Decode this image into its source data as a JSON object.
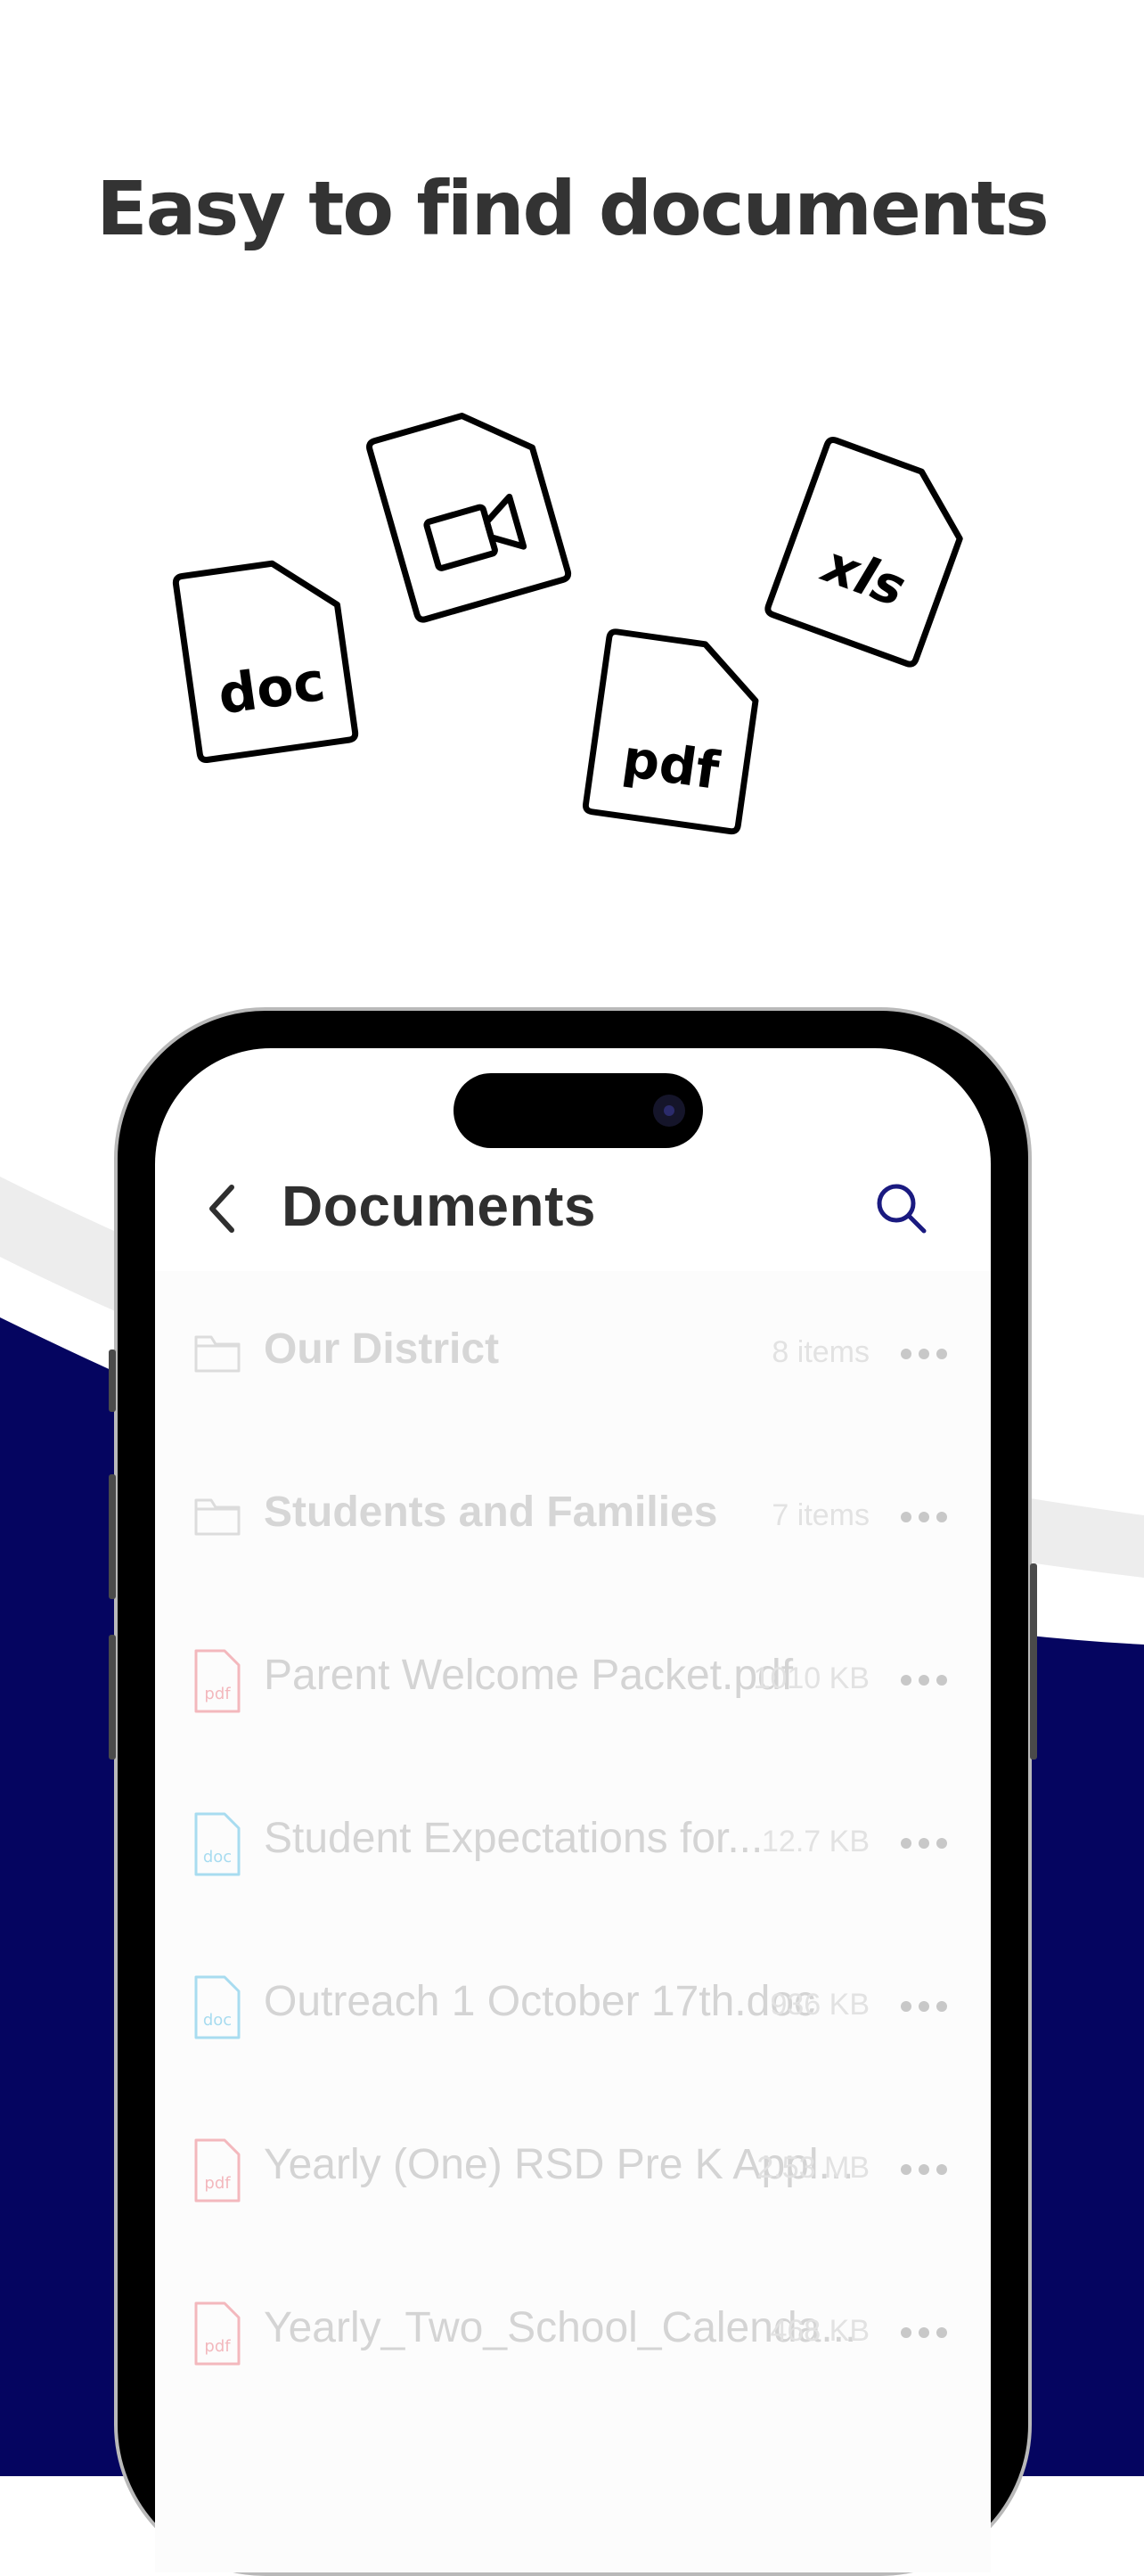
{
  "headline": "Easy to find documents",
  "colors": {
    "navy": "#050560",
    "band": "#ededed",
    "headline": "#333333",
    "search": "#1a1a80",
    "pdf_icon": "#f3b8bd",
    "doc_icon": "#a8dcf0"
  },
  "file_types": {
    "doc": "doc",
    "pdf": "pdf",
    "xls": "xls",
    "video": "video-camera-icon"
  },
  "app": {
    "nav_title": "Documents",
    "items": [
      {
        "type": "folder",
        "name": "Our District",
        "meta": "8 items"
      },
      {
        "type": "folder",
        "name": "Students and Families",
        "meta": "7 items"
      },
      {
        "type": "pdf",
        "icon_label": "pdf",
        "name": "Parent Welcome Packet.pdf",
        "meta": "1010 KB"
      },
      {
        "type": "doc",
        "icon_label": "doc",
        "name": "Student Expectations for...",
        "meta": "12.7 KB"
      },
      {
        "type": "doc",
        "icon_label": "doc",
        "name": "Outreach 1 October 17th.doc",
        "meta": "936 KB"
      },
      {
        "type": "pdf",
        "icon_label": "pdf",
        "name": "Yearly (One) RSD Pre K Appl...",
        "meta": "2.53 MB"
      },
      {
        "type": "pdf",
        "icon_label": "pdf",
        "name": "Yearly_Two_School_Calenda...",
        "meta": "468 KB"
      }
    ]
  }
}
